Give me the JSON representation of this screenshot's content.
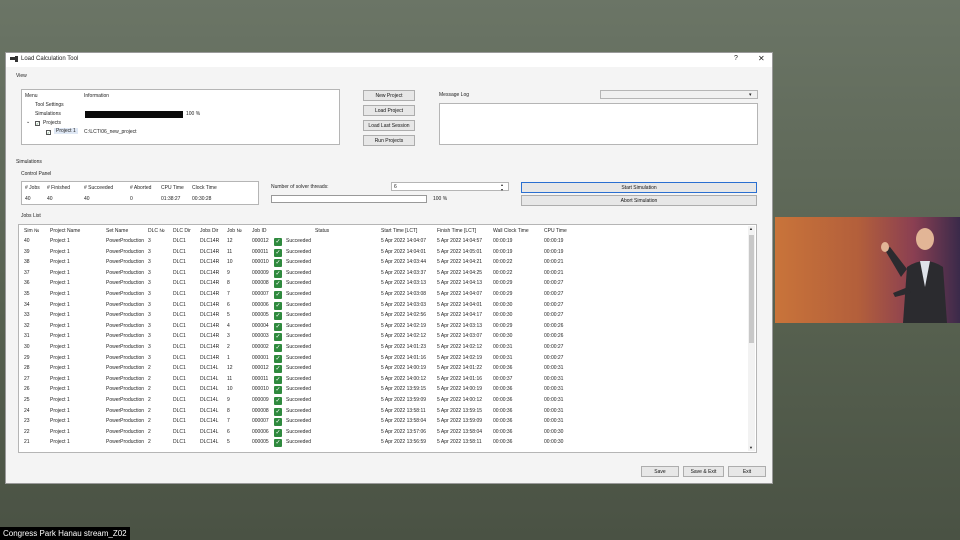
{
  "window": {
    "title": "Load Calculation Tool",
    "help": "?",
    "close": "✕"
  },
  "sections": {
    "view": "View",
    "simulations": "Simulations",
    "control_panel": "Control Panel",
    "jobs_list": "Jobs List"
  },
  "tree": {
    "headers": [
      "Menu",
      "Information"
    ],
    "items": [
      "Tool Settings",
      "Simulations",
      "Projects",
      "Project 1"
    ],
    "simulations_progress": "100 %",
    "project_path": "C:\\LCT\\06_new_project"
  },
  "buttons": {
    "new_project": "New Project",
    "load_project": "Load Project",
    "load_last_session": "Load Last Session",
    "run_projects": "Run Projects",
    "start_simulation": "Start Simulation",
    "abort_simulation": "Abort Simulation",
    "save": "Save",
    "save_exit": "Save & Exit",
    "exit": "Exit"
  },
  "message_log": {
    "label": "Message Log"
  },
  "control_panel": {
    "headers": [
      "# Jobs",
      "# Finished",
      "# Succeeded",
      "# Aborted",
      "CPU Time",
      "Clock Time"
    ],
    "values": [
      "40",
      "40",
      "40",
      "0",
      "01:38:27",
      "00:30:28"
    ]
  },
  "solver": {
    "label": "Number of solver threads:",
    "value": "6",
    "progress": "100 %"
  },
  "jobs": {
    "headers": [
      "Sim №",
      "Project Name",
      "Set Name",
      "DLC №",
      "DLC Dir",
      "Jobs Dir",
      "Job №",
      "Job ID",
      "Status",
      "Start Time [LCT]",
      "Finish Time [LCT]",
      "Wall Clock Time",
      "CPU Time"
    ],
    "rows": [
      [
        "40",
        "Project 1",
        "PowerProduction",
        "3",
        "DLC1",
        "DLC14R",
        "12",
        "000012",
        "Succeeded",
        "5 Apr 2022 14:04:07",
        "5 Apr 2022 14:04:57",
        "00:00:19",
        "00:00:19"
      ],
      [
        "39",
        "Project 1",
        "PowerProduction",
        "3",
        "DLC1",
        "DLC14R",
        "11",
        "000011",
        "Succeeded",
        "5 Apr 2022 14:04:01",
        "5 Apr 2022 14:05:01",
        "00:00:19",
        "00:00:19"
      ],
      [
        "38",
        "Project 1",
        "PowerProduction",
        "3",
        "DLC1",
        "DLC14R",
        "10",
        "000010",
        "Succeeded",
        "5 Apr 2022 14:03:44",
        "5 Apr 2022 14:04:21",
        "00:00:22",
        "00:00:21"
      ],
      [
        "37",
        "Project 1",
        "PowerProduction",
        "3",
        "DLC1",
        "DLC14R",
        "9",
        "000009",
        "Succeeded",
        "5 Apr 2022 14:03:37",
        "5 Apr 2022 14:04:25",
        "00:00:22",
        "00:00:21"
      ],
      [
        "36",
        "Project 1",
        "PowerProduction",
        "3",
        "DLC1",
        "DLC14R",
        "8",
        "000008",
        "Succeeded",
        "5 Apr 2022 14:03:13",
        "5 Apr 2022 14:04:13",
        "00:00:29",
        "00:00:27"
      ],
      [
        "35",
        "Project 1",
        "PowerProduction",
        "3",
        "DLC1",
        "DLC14R",
        "7",
        "000007",
        "Succeeded",
        "5 Apr 2022 14:03:08",
        "5 Apr 2022 14:04:07",
        "00:00:29",
        "00:00:27"
      ],
      [
        "34",
        "Project 1",
        "PowerProduction",
        "3",
        "DLC1",
        "DLC14R",
        "6",
        "000006",
        "Succeeded",
        "5 Apr 2022 14:03:03",
        "5 Apr 2022 14:04:01",
        "00:00:30",
        "00:00:27"
      ],
      [
        "33",
        "Project 1",
        "PowerProduction",
        "3",
        "DLC1",
        "DLC14R",
        "5",
        "000005",
        "Succeeded",
        "5 Apr 2022 14:02:56",
        "5 Apr 2022 14:04:17",
        "00:00:30",
        "00:00:27"
      ],
      [
        "32",
        "Project 1",
        "PowerProduction",
        "3",
        "DLC1",
        "DLC14R",
        "4",
        "000004",
        "Succeeded",
        "5 Apr 2022 14:02:19",
        "5 Apr 2022 14:03:13",
        "00:00:29",
        "00:00:26"
      ],
      [
        "31",
        "Project 1",
        "PowerProduction",
        "3",
        "DLC1",
        "DLC14R",
        "3",
        "000003",
        "Succeeded",
        "5 Apr 2022 14:02:12",
        "5 Apr 2022 14:03:07",
        "00:00:30",
        "00:00:26"
      ],
      [
        "30",
        "Project 1",
        "PowerProduction",
        "3",
        "DLC1",
        "DLC14R",
        "2",
        "000002",
        "Succeeded",
        "5 Apr 2022 14:01:23",
        "5 Apr 2022 14:02:12",
        "00:00:31",
        "00:00:27"
      ],
      [
        "29",
        "Project 1",
        "PowerProduction",
        "3",
        "DLC1",
        "DLC14R",
        "1",
        "000001",
        "Succeeded",
        "5 Apr 2022 14:01:16",
        "5 Apr 2022 14:02:19",
        "00:00:31",
        "00:00:27"
      ],
      [
        "28",
        "Project 1",
        "PowerProduction",
        "2",
        "DLC1",
        "DLC14L",
        "12",
        "000012",
        "Succeeded",
        "5 Apr 2022 14:00:19",
        "5 Apr 2022 14:01:22",
        "00:00:36",
        "00:00:31"
      ],
      [
        "27",
        "Project 1",
        "PowerProduction",
        "2",
        "DLC1",
        "DLC14L",
        "11",
        "000011",
        "Succeeded",
        "5 Apr 2022 14:00:12",
        "5 Apr 2022 14:01:16",
        "00:00:37",
        "00:00:31"
      ],
      [
        "26",
        "Project 1",
        "PowerProduction",
        "2",
        "DLC1",
        "DLC14L",
        "10",
        "000010",
        "Succeeded",
        "5 Apr 2022 13:59:15",
        "5 Apr 2022 14:00:19",
        "00:00:36",
        "00:00:31"
      ],
      [
        "25",
        "Project 1",
        "PowerProduction",
        "2",
        "DLC1",
        "DLC14L",
        "9",
        "000009",
        "Succeeded",
        "5 Apr 2022 13:59:09",
        "5 Apr 2022 14:00:12",
        "00:00:36",
        "00:00:31"
      ],
      [
        "24",
        "Project 1",
        "PowerProduction",
        "2",
        "DLC1",
        "DLC14L",
        "8",
        "000008",
        "Succeeded",
        "5 Apr 2022 13:58:11",
        "5 Apr 2022 13:59:15",
        "00:00:36",
        "00:00:31"
      ],
      [
        "23",
        "Project 1",
        "PowerProduction",
        "2",
        "DLC1",
        "DLC14L",
        "7",
        "000007",
        "Succeeded",
        "5 Apr 2022 13:58:04",
        "5 Apr 2022 13:59:09",
        "00:00:36",
        "00:00:31"
      ],
      [
        "22",
        "Project 1",
        "PowerProduction",
        "2",
        "DLC1",
        "DLC14L",
        "6",
        "000006",
        "Succeeded",
        "5 Apr 2022 13:57:06",
        "5 Apr 2022 13:58:04",
        "00:00:36",
        "00:00:30"
      ],
      [
        "21",
        "Project 1",
        "PowerProduction",
        "2",
        "DLC1",
        "DLC14L",
        "5",
        "000005",
        "Succeeded",
        "5 Apr 2022 13:56:59",
        "5 Apr 2022 13:58:11",
        "00:00:36",
        "00:00:30"
      ]
    ]
  },
  "stream_caption": "Congress Park Hanau stream_Z02"
}
